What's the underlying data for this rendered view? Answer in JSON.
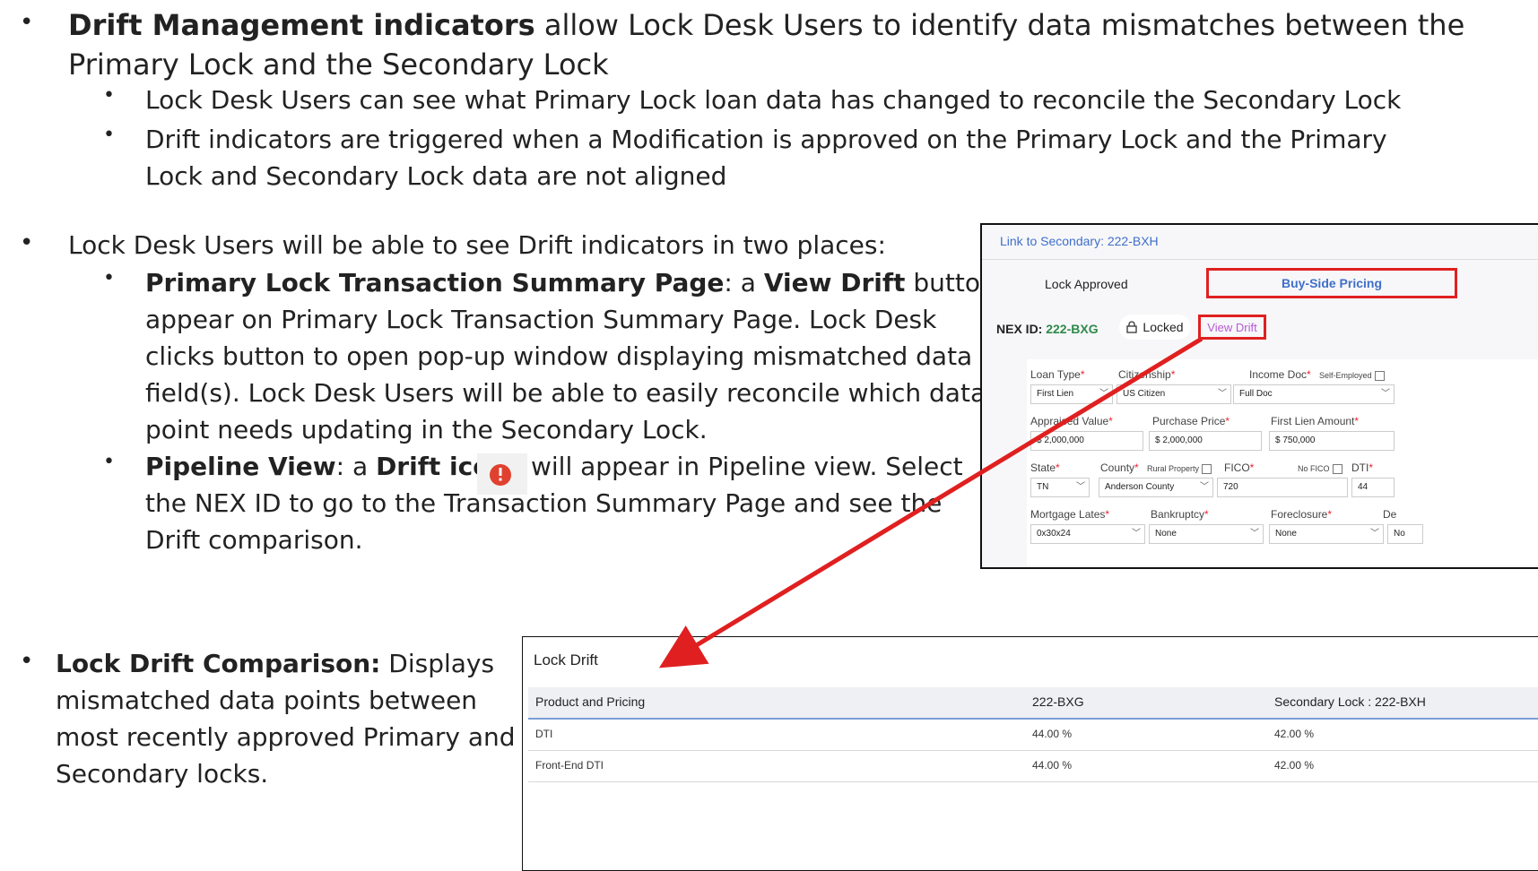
{
  "bullets": {
    "b1": {
      "bold": "Drift Management indicators",
      "line1_rest": " allow Lock Desk Users to identify data mismatches between the",
      "line2": "Primary Lock and the Secondary Lock"
    },
    "b1a": "Lock Desk Users can see what Primary Lock loan data has changed to reconcile the Secondary Lock",
    "b1b_line1": "Drift indicators are triggered when a Modification is approved on the Primary Lock and the Primary",
    "b1b_line2": "Lock and Secondary Lock data are not aligned",
    "b2": "Lock Desk Users will be able to see Drift indicators in two places:",
    "b2a": {
      "bold1": "Primary Lock Transaction Summary Page",
      "mid1": ": a ",
      "bold2": "View Drift",
      "end1": " button will",
      "line2": "appear on Primary Lock Transaction Summary Page. Lock Desk",
      "line3": "clicks button to open pop-up window displaying mismatched data",
      "line4": "field(s). Lock Desk Users will be able to easily reconcile which data",
      "line5": "point needs updating in the Secondary Lock."
    },
    "b2b": {
      "bold1": "Pipeline View",
      "mid1": ": a ",
      "bold2": "Drift icon",
      "end1": "will appear in Pipeline view. Select",
      "line2": "the NEX ID to go to the Transaction Summary Page and see the",
      "line3": "Drift comparison."
    },
    "b3": {
      "bold": "Lock Drift Comparison:",
      "rest1": " Displays",
      "line2": "mismatched data points between",
      "line3": "most recently approved Primary and",
      "line4": "Secondary locks."
    }
  },
  "summary_screenshot": {
    "link": "Link to Secondary: 222-BXH",
    "tab_lock_approved": "Lock Approved",
    "tab_buy_side": "Buy-Side Pricing",
    "nex_label": "NEX ID: ",
    "nex_id": "222-BXG",
    "locked": "Locked",
    "view_drift": "View Drift",
    "labels": {
      "loan_type": "Loan Type",
      "citizenship": "Citizenship",
      "income_doc": "Income Doc",
      "self_employed": "Self-Employed",
      "appraised_value": "Appraised Value",
      "purchase_price": "Purchase Price",
      "first_lien_amount": "First Lien Amount",
      "state": "State",
      "county": "County",
      "rural_property": "Rural Property",
      "fico": "FICO",
      "no_fico": "No FICO",
      "dti": "DTI",
      "mortgage_lates": "Mortgage Lates",
      "bankruptcy": "Bankruptcy",
      "foreclosure": "Foreclosure",
      "de": "De"
    },
    "values": {
      "loan_type": "First Lien",
      "citizenship": "US Citizen",
      "income_doc": "Full Doc",
      "appraised_value": "2,000,000",
      "purchase_price": "2,000,000",
      "first_lien_amount": "750,000",
      "currency": "$",
      "state": "TN",
      "county": "Anderson County",
      "fico": "720",
      "dti": "44",
      "mortgage_lates": "0x30x24",
      "bankruptcy": "None",
      "foreclosure": "None",
      "de": "No"
    }
  },
  "drift_screenshot": {
    "title": "Lock Drift",
    "headers": [
      "Product and Pricing",
      "222-BXG",
      "Secondary Lock : 222-BXH"
    ],
    "rows": [
      [
        "DTI",
        "44.00 %",
        "42.00 %"
      ],
      [
        "Front-End DTI",
        "44.00 %",
        "42.00 %"
      ]
    ]
  },
  "colors": {
    "highlight_red": "#e02020",
    "link_blue": "#3f6fc8",
    "nex_green": "#2e8a4a",
    "drift_icon_red": "#e0412f"
  }
}
